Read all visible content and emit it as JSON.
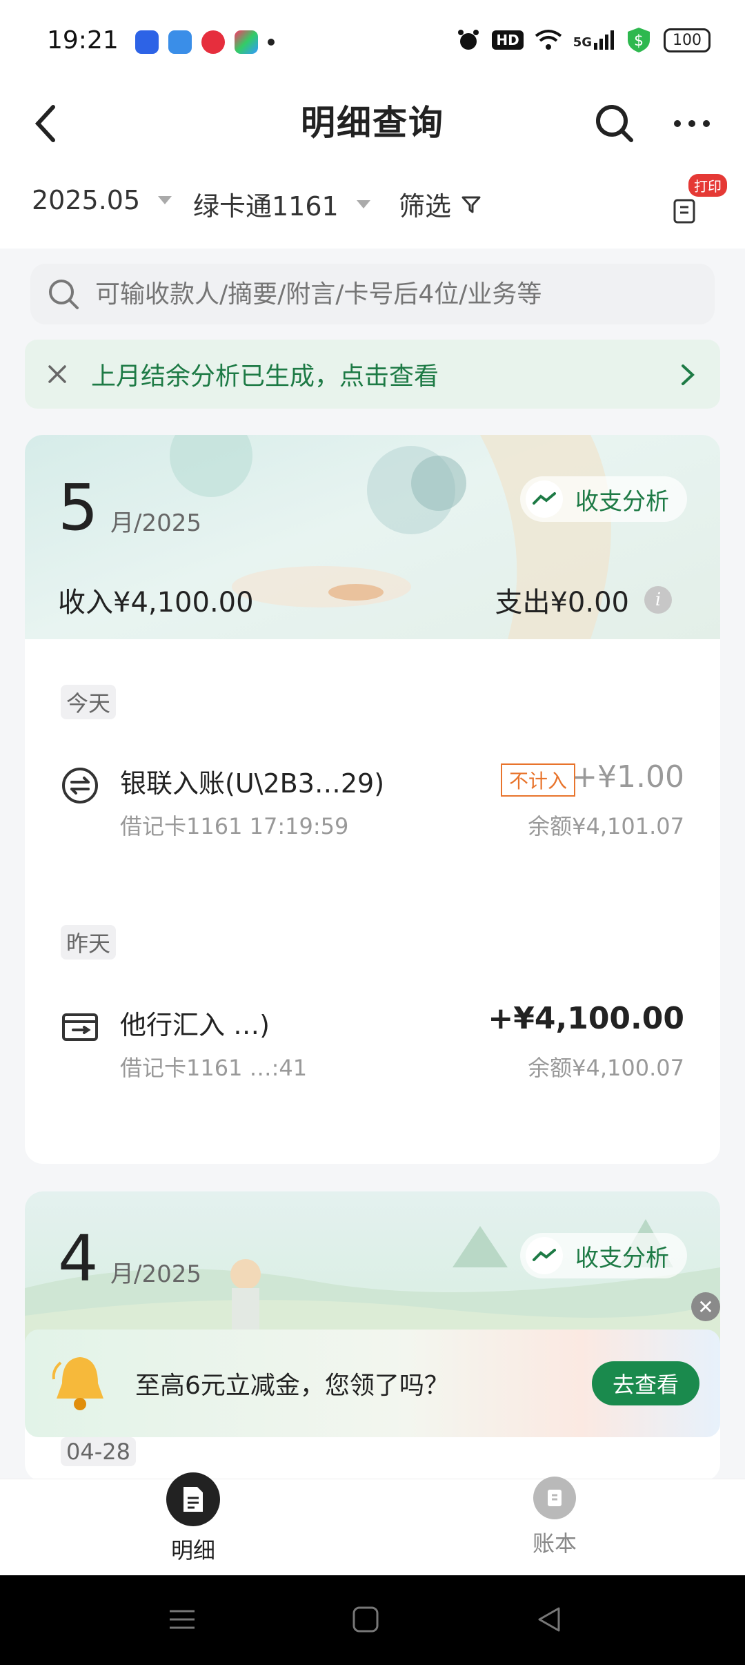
{
  "status_bar": {
    "time": "19:21",
    "hd": "HD",
    "signal": "5G",
    "battery": "100"
  },
  "header": {
    "title": "明细查询"
  },
  "filters": {
    "month": "2025.05",
    "account": "绿卡通1161",
    "filter_label": "筛选",
    "print_badge": "打印"
  },
  "search": {
    "placeholder": "可输收款人/摘要/附言/卡号后4位/业务等"
  },
  "banner": {
    "text": "上月结余分析已生成，点击查看"
  },
  "may": {
    "month": "5",
    "year_label": "月/2025",
    "analysis_label": "收支分析",
    "income": "收入¥4,100.00",
    "expense": "支出¥0.00",
    "groups": [
      {
        "day": "今天",
        "txn": {
          "name": "银联入账(U\\2B3…29)",
          "sub": "借记卡1161 17:19:59",
          "tag": "不计入",
          "amount": "+¥1.00",
          "balance": "余额¥4,101.07"
        }
      },
      {
        "day": "昨天",
        "txn": {
          "name": "他行汇入 …)",
          "sub": "借记卡1161 …:41",
          "amount": "+¥4,100.00",
          "balance": "余额¥4,100.07"
        }
      }
    ]
  },
  "april": {
    "month": "4",
    "year_label": "月/2025",
    "analysis_label": "收支分析",
    "first_date": "04-28"
  },
  "promo": {
    "text": "至高6元立减金，您领了吗？",
    "button": "去查看"
  },
  "bottom_nav": {
    "items": [
      {
        "label": "明细"
      },
      {
        "label": "账本"
      }
    ]
  },
  "colors": {
    "brand_green": "#1d7a45",
    "button_green": "#1a8a4d",
    "tag_orange": "#e8742c"
  }
}
